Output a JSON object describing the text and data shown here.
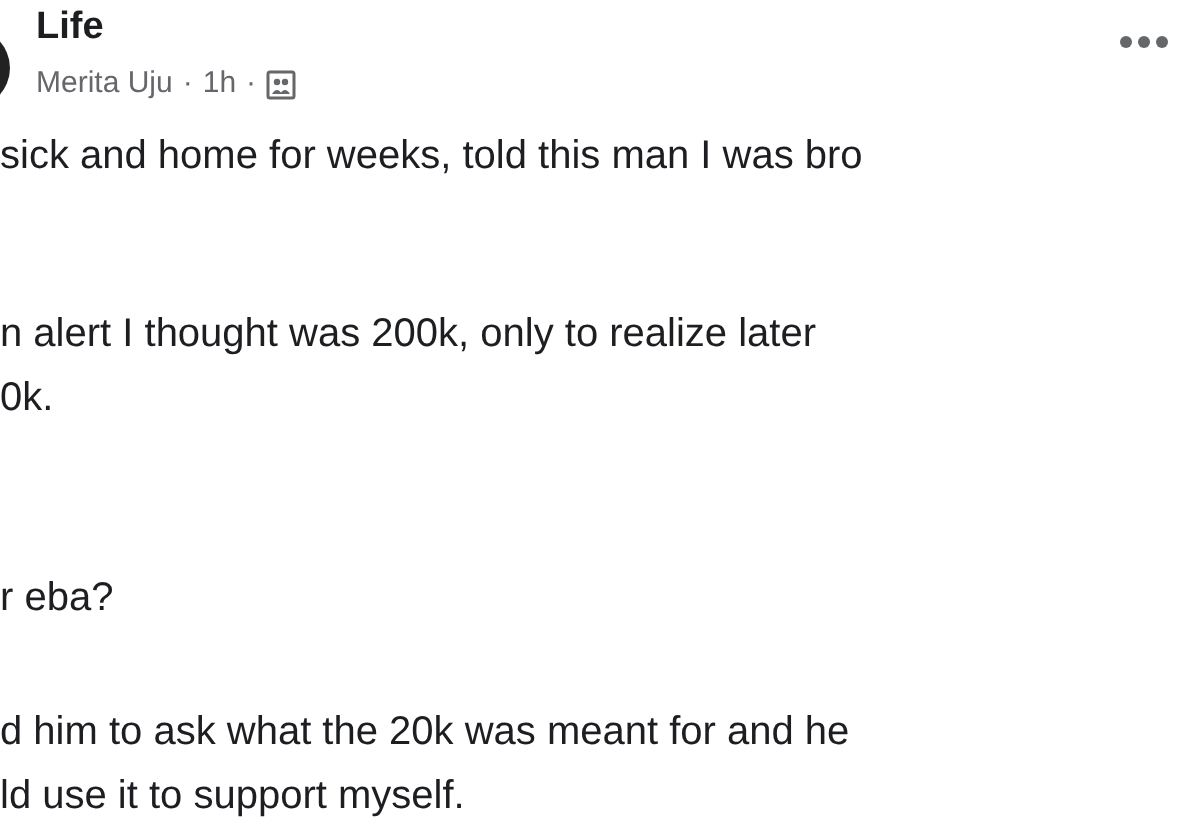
{
  "post": {
    "title": "Life",
    "author": "Merita Uju",
    "separator_1": "·",
    "time": "1h",
    "separator_2": "·",
    "paragraphs": [
      [
        "sick and home for weeks, told this man I was bro"
      ],
      [
        "n alert I thought was 200k, only to realize later",
        "0k."
      ],
      [
        "r eba?"
      ],
      [
        "d him to ask what the 20k was meant for and he",
        "ld use it to support myself."
      ]
    ]
  }
}
